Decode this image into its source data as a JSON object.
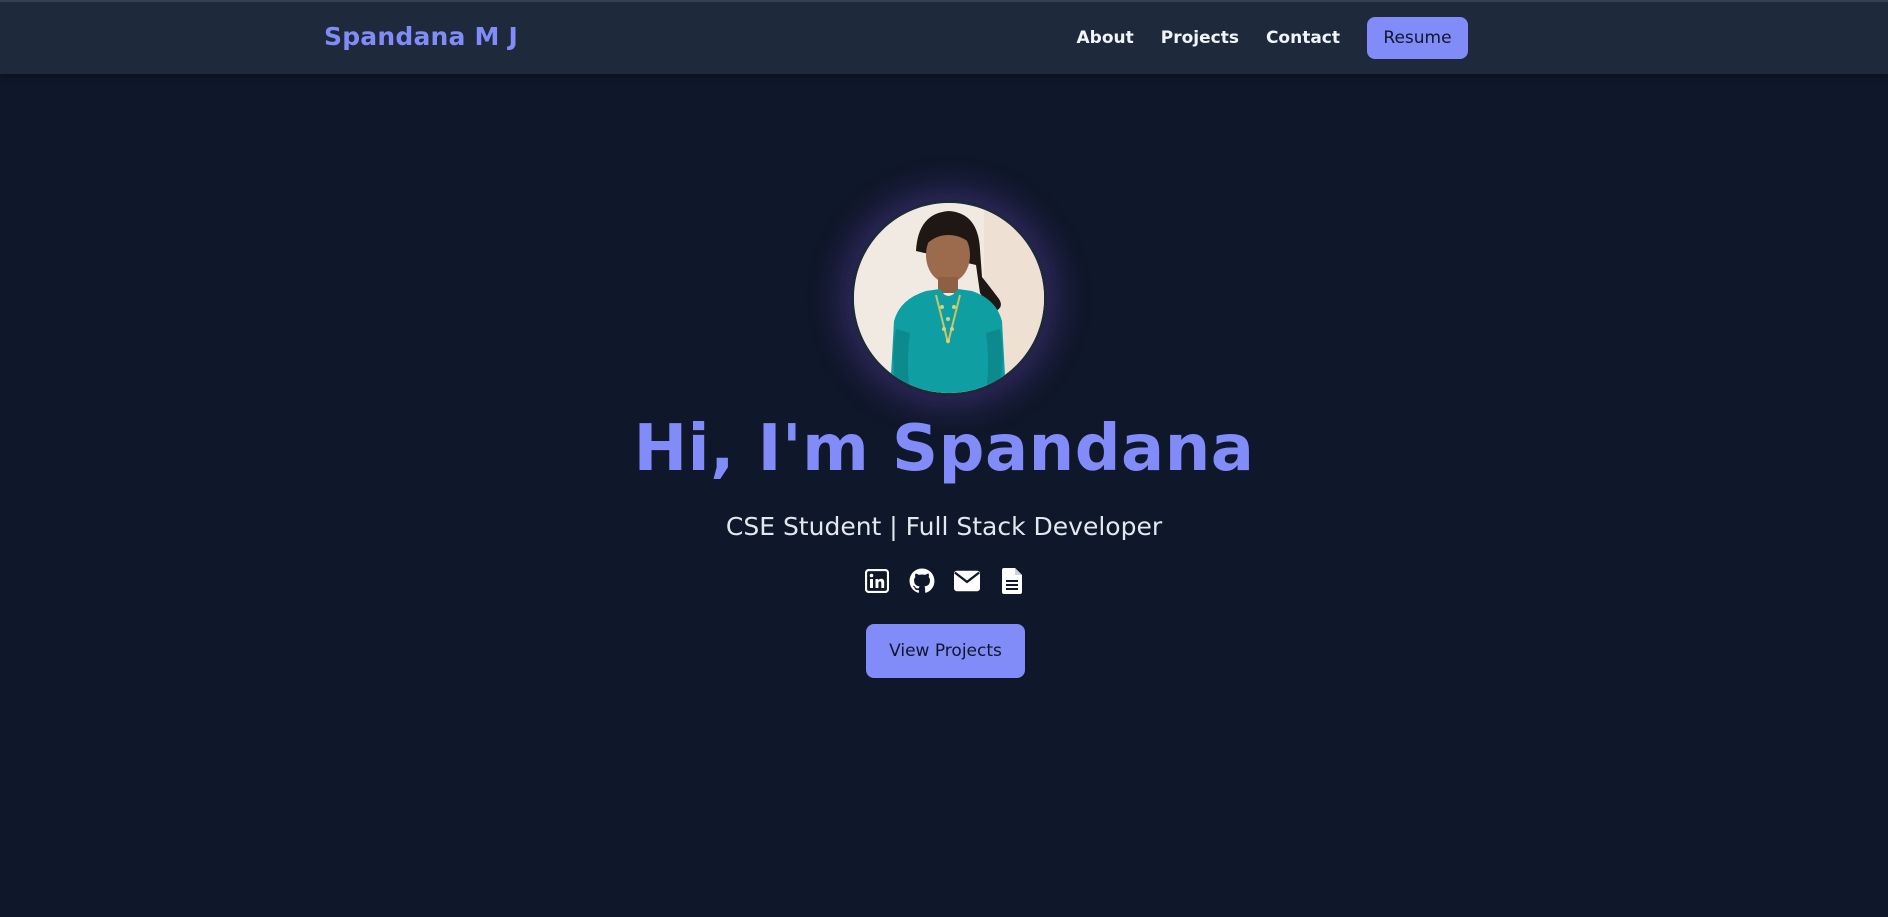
{
  "nav": {
    "brand": "Spandana M J",
    "links": [
      {
        "label": "About"
      },
      {
        "label": "Projects"
      },
      {
        "label": "Contact"
      }
    ],
    "resume_label": "Resume"
  },
  "hero": {
    "title": "Hi, I'm Spandana",
    "subtitle": "CSE Student | Full Stack Developer",
    "cta_label": "View Projects",
    "socials": [
      {
        "icon": "linkedin-icon"
      },
      {
        "icon": "github-icon"
      },
      {
        "icon": "envelope-icon"
      },
      {
        "icon": "document-icon"
      }
    ]
  },
  "colors": {
    "background": "#0f172a",
    "navbar": "#1e293b",
    "accent": "#818cf8",
    "text": "#f1f5f9"
  }
}
